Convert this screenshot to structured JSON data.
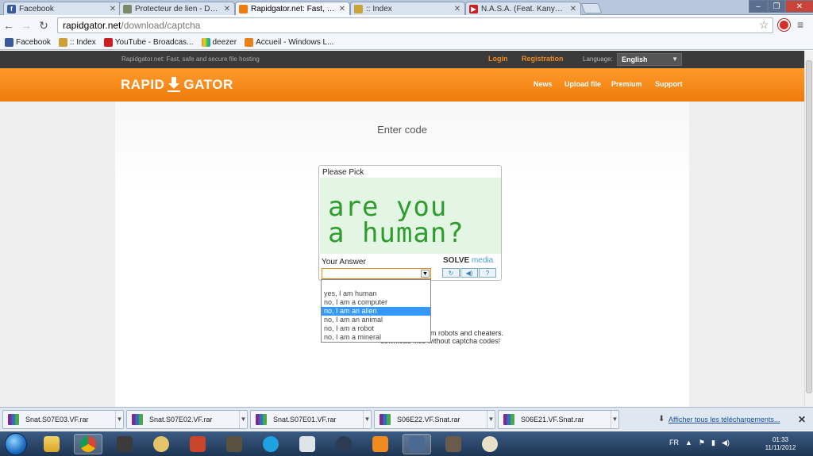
{
  "browser": {
    "tabs": [
      {
        "label": "Facebook",
        "icon_color": "#3b5998",
        "icon_letter": "f"
      },
      {
        "label": "Protecteur de lien - DL-Pr",
        "icon_color": "#7a8a6a",
        "icon_letter": ""
      },
      {
        "label": "Rapidgator.net: Fast, safe",
        "icon_color": "#ee7c0c",
        "icon_letter": ""
      },
      {
        "label": ":: Index",
        "icon_color": "#c9a23a",
        "icon_letter": ""
      },
      {
        "label": "N.A.S.A. (Feat. Kanye Wes",
        "icon_color": "#cc1f1f",
        "icon_letter": "▶"
      }
    ],
    "url_host": "rapidgator.net",
    "url_path": "/download/captcha",
    "bookmarks": [
      {
        "label": "Facebook",
        "color": "#3b5998"
      },
      {
        "label": ":: Index",
        "color": "#c9a23a"
      },
      {
        "label": "YouTube - Broadcas...",
        "color": "#cc1f1f"
      },
      {
        "label": "deezer",
        "color": "#f08a1e"
      },
      {
        "label": "Accueil - Windows L...",
        "color": "#e8811a"
      }
    ]
  },
  "site": {
    "tagline": "Rapidgator.net: Fast, safe and secure file hosting",
    "login": "Login",
    "registration": "Registration",
    "language_label": "Language:",
    "language_value": "English",
    "logo_left": "RAPID",
    "logo_right": "GATOR",
    "nav": [
      "News",
      "Upload file",
      "Premium",
      "Support"
    ],
    "heading": "Enter code"
  },
  "captcha": {
    "prompt": "Please Pick",
    "line1": "are you",
    "line2": "a human?",
    "answer_label": "Your Answer",
    "brand_a": "SOLVE",
    "brand_b": "media",
    "options": [
      "yes, I am human",
      "no, I am a computer",
      "no, I am an alien",
      "no, I am an animal",
      "no, I am a robot",
      "no, I am a mineral"
    ],
    "selected_index": 2,
    "partial_text_1": "om robots and cheaters.",
    "partial_text_2": "download files without captcha codes!"
  },
  "downloads": {
    "items": [
      "Snat.S07E03.VF.rar",
      "Snat.S07E02.VF.rar",
      "Snat.S07E01.VF.rar",
      "S06E22.VF.Snat.rar",
      "S06E21.VF.Snat.rar"
    ],
    "show_all": "Afficher tous les téléchargements..."
  },
  "taskbar": {
    "lang": "FR",
    "time": "01:33",
    "date": "11/11/2012"
  }
}
